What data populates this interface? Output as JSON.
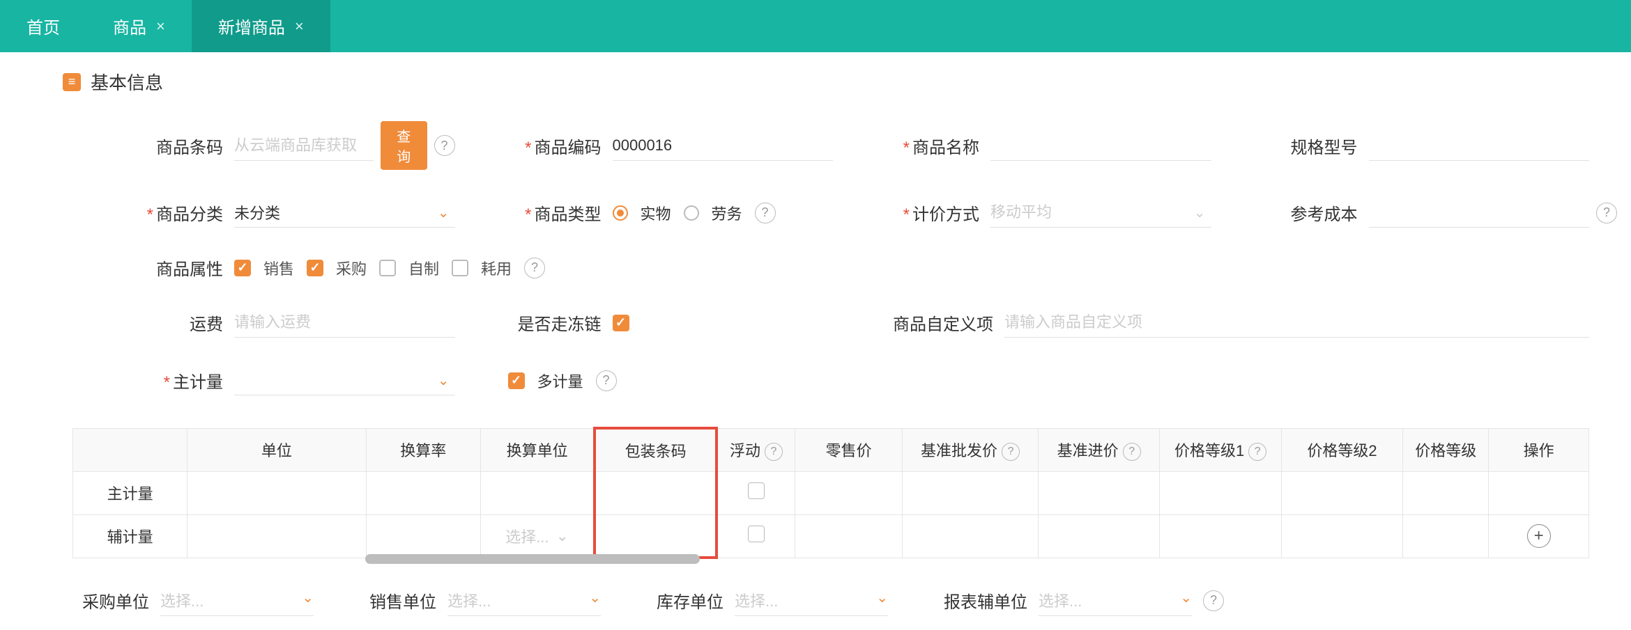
{
  "tabs": {
    "home": "首页",
    "products": "商品",
    "add": "新增商品"
  },
  "section": {
    "basic_info": "基本信息"
  },
  "labels": {
    "barcode": "商品条码",
    "code": "商品编码",
    "name": "商品名称",
    "spec": "规格型号",
    "category": "商品分类",
    "type": "商品类型",
    "pricing": "计价方式",
    "ref_cost": "参考成本",
    "attr": "商品属性",
    "freight": "运费",
    "cold_chain": "是否走冻链",
    "custom": "商品自定义项",
    "main_unit": "主计量",
    "multi_unit": "多计量"
  },
  "placeholders": {
    "barcode": "从云端商品库获取",
    "freight": "请输入运费",
    "custom": "请输入商品自定义项",
    "select": "选择...",
    "pricing": "移动平均"
  },
  "values": {
    "code": "0000016",
    "category": "未分类"
  },
  "buttons": {
    "query": "查询"
  },
  "radio": {
    "physical": "实物",
    "service": "劳务"
  },
  "checks": {
    "sale": "销售",
    "purchase": "采购",
    "self": "自制",
    "consume": "耗用"
  },
  "table": {
    "head_blank": "",
    "unit": "单位",
    "rate": "换算率",
    "rate_unit": "换算单位",
    "pack_code": "包装条码",
    "float": "浮动",
    "retail": "零售价",
    "wholesale": "基准批发价",
    "base_in": "基准进价",
    "lvl1": "价格等级1",
    "lvl2": "价格等级2",
    "lvl3": "价格等级",
    "ops": "操作",
    "row_main": "主计量",
    "row_aux": "辅计量",
    "select_cell": "选择..."
  },
  "units": {
    "purchase": "采购单位",
    "sale": "销售单位",
    "stock": "库存单位",
    "report": "报表辅单位",
    "select": "选择..."
  }
}
